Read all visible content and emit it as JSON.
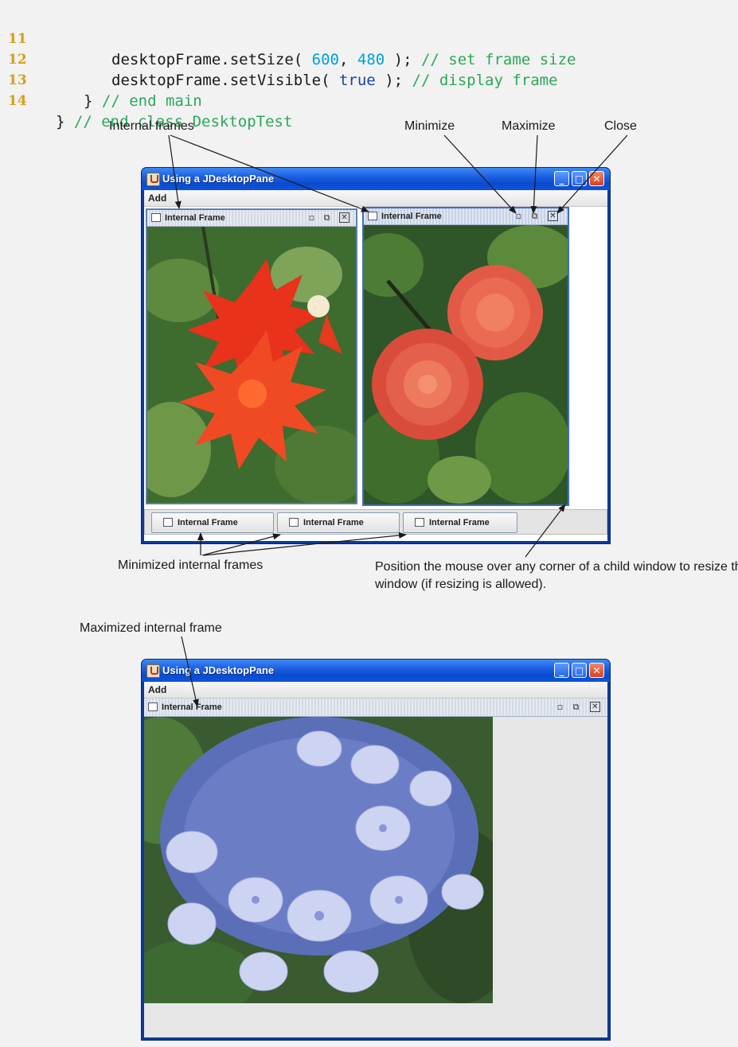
{
  "code": {
    "lines": [
      {
        "num": "11",
        "parts": [
          {
            "t": "desktopFrame.setSize( ",
            "c": "plain"
          },
          {
            "t": "600",
            "c": "num"
          },
          {
            "t": ", ",
            "c": "plain"
          },
          {
            "t": "480",
            "c": "num"
          },
          {
            "t": " ); ",
            "c": "plain"
          },
          {
            "t": "// set frame size",
            "c": "cmt"
          }
        ]
      },
      {
        "num": "12",
        "parts": [
          {
            "t": "desktopFrame.setVisible( ",
            "c": "plain"
          },
          {
            "t": "true",
            "c": "kw"
          },
          {
            "t": " ); ",
            "c": "plain"
          },
          {
            "t": "// display frame",
            "c": "cmt"
          }
        ]
      },
      {
        "num": "13",
        "parts": [
          {
            "t": "} ",
            "c": "plain"
          },
          {
            "t": "// end main",
            "c": "cmt"
          }
        ]
      },
      {
        "num": "14",
        "parts": [
          {
            "t": "} ",
            "c": "plain"
          },
          {
            "t": "// end class DesktopTest",
            "c": "cmt"
          }
        ]
      }
    ]
  },
  "annotations": {
    "internal_frames": "Internal frames",
    "minimize": "Minimize",
    "maximize": "Maximize",
    "close": "Close",
    "minimized_frames": "Minimized internal frames",
    "resize_note": "Position the mouse over any corner of a child window to resize the window (if resizing is allowed).",
    "maximized_frame": "Maximized internal frame"
  },
  "window1": {
    "title": "Using a JDesktopPane",
    "menu": "Add",
    "frames": [
      {
        "title": "Internal Frame",
        "photo": "red-dahlia-photo"
      },
      {
        "title": "Internal Frame",
        "photo": "coral-dahlia-photo"
      }
    ],
    "minimized": [
      "Internal Frame",
      "Internal Frame",
      "Internal Frame"
    ]
  },
  "window2": {
    "title": "Using a JDesktopPane",
    "menu": "Add",
    "frame_title": "Internal Frame",
    "photo": "hydrangea-photo"
  },
  "icons": {
    "minimize": "_",
    "maximize": "□",
    "close": "✕",
    "iconify": "▫",
    "restore": "⧉",
    "frame_close": "✕"
  },
  "colors": {
    "titlebar": "#1d5fe0",
    "close_button": "#d8401c",
    "line_numbers": "#d4a017",
    "code_number": "#00a0d8",
    "code_keyword": "#1f3ea8",
    "code_comment": "#2aa85a"
  }
}
